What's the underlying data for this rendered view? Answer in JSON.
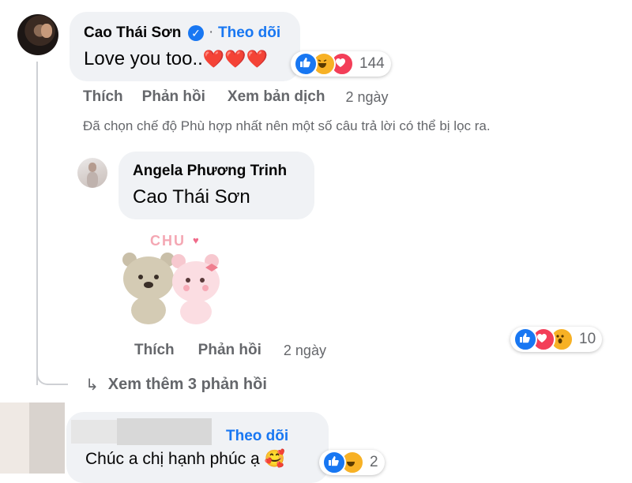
{
  "comment1": {
    "author": "Cao Thái Sơn",
    "follow_label": "Theo dõi",
    "text": "Love you too..",
    "hearts": "❤️❤️❤️",
    "reactions": {
      "count": "144",
      "icons": [
        "like-icon",
        "haha-icon",
        "love-icon"
      ]
    },
    "actions": {
      "like": "Thích",
      "reply": "Phản hồi",
      "translate": "Xem bản dịch",
      "time": "2 ngày"
    },
    "filter_notice": "Đã chọn chế độ Phù hợp nhất nên một số câu trả lời có thể bị lọc ra."
  },
  "reply1": {
    "author": "Angela Phương Trinh",
    "mention": "Cao Thái Sơn",
    "sticker_text": "CHU",
    "reactions": {
      "count": "10",
      "icons": [
        "like-icon",
        "love-icon",
        "wow-icon"
      ]
    },
    "actions": {
      "like": "Thích",
      "reply": "Phản hồi",
      "time": "2 ngày"
    }
  },
  "view_more": {
    "label": "Xem thêm 3 phản hồi"
  },
  "comment2": {
    "follow_label": "Theo dõi",
    "text": "Chúc a chị hạnh phúc ạ",
    "emoji": "🥰",
    "reactions": {
      "count": "2"
    }
  },
  "colors": {
    "accent": "#1877f2",
    "bubble": "#f0f2f5",
    "muted": "#65676b",
    "like": "#1877f2",
    "love": "#f33e58",
    "haha": "#f7b125"
  }
}
